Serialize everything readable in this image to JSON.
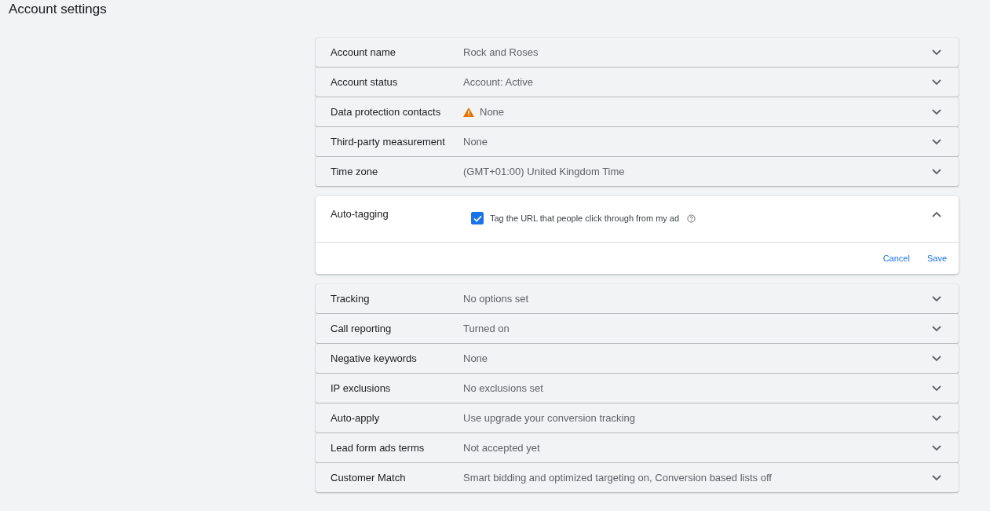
{
  "title": "Account settings",
  "settings": [
    {
      "label": "Account name",
      "value": "Rock and Roses",
      "warning": false,
      "expanded": false
    },
    {
      "label": "Account status",
      "value": "Account: Active",
      "warning": false,
      "expanded": false
    },
    {
      "label": "Data protection contacts",
      "value": "None",
      "warning": true,
      "expanded": false
    },
    {
      "label": "Third-party measurement",
      "value": "None",
      "warning": false,
      "expanded": false
    },
    {
      "label": "Time zone",
      "value": "(GMT+01:00) United Kingdom Time",
      "warning": false,
      "expanded": false
    },
    {
      "label": "Auto-tagging",
      "expanded": true,
      "option": {
        "label": "Tag the URL that people click through from my ad",
        "checked": true
      },
      "actions": [
        "Cancel",
        "Save"
      ]
    },
    {
      "label": "Tracking",
      "value": "No options set",
      "warning": false,
      "expanded": false
    },
    {
      "label": "Call reporting",
      "value": "Turned on",
      "warning": false,
      "expanded": false
    },
    {
      "label": "Negative keywords",
      "value": "None",
      "warning": false,
      "expanded": false
    },
    {
      "label": "IP exclusions",
      "value": "No exclusions set",
      "warning": false,
      "expanded": false
    },
    {
      "label": "Auto-apply",
      "value": "Use upgrade your conversion tracking",
      "warning": false,
      "expanded": false
    },
    {
      "label": "Lead form ads terms",
      "value": "Not accepted yet",
      "warning": false,
      "expanded": false
    },
    {
      "label": "Customer Match",
      "value": "Smart bidding and optimized targeting on, Conversion based lists off",
      "warning": false,
      "expanded": false
    }
  ]
}
